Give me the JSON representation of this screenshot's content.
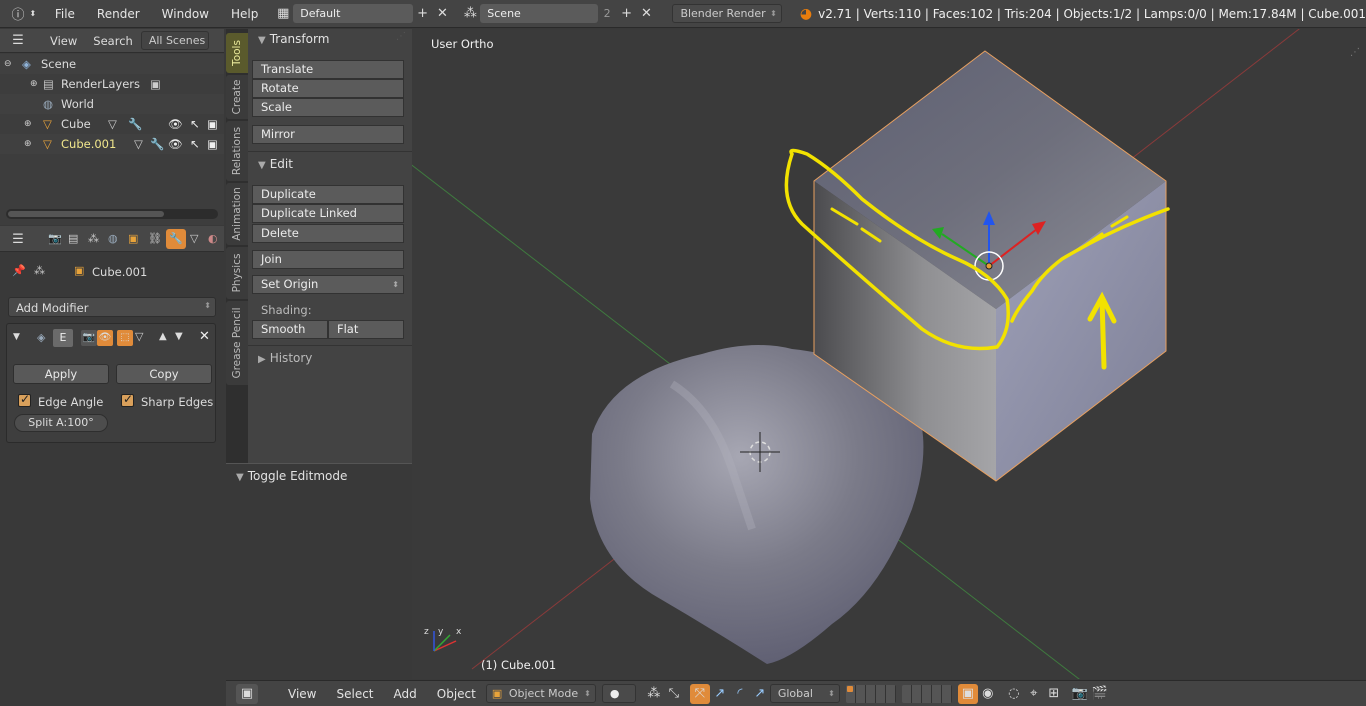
{
  "topbar": {
    "menus": [
      "File",
      "Render",
      "Window",
      "Help"
    ],
    "layout_name": "Default",
    "scene_name": "Scene",
    "scene_users": "2",
    "render_engine": "Blender Render",
    "stats": "v2.71 | Verts:110 | Faces:102 | Tris:204 | Objects:1/2 | Lamps:0/0 | Mem:17.84M | Cube.001"
  },
  "outliner": {
    "header": {
      "view": "View",
      "search": "Search",
      "filter": "All Scenes"
    },
    "rows": [
      {
        "label": "Scene",
        "icon": "scene-icon"
      },
      {
        "label": "RenderLayers",
        "icon": "renderlayers-icon"
      },
      {
        "label": "World",
        "icon": "world-icon"
      },
      {
        "label": "Cube",
        "icon": "mesh-object-icon"
      },
      {
        "label": "Cube.001",
        "icon": "mesh-object-icon",
        "selected": true
      }
    ]
  },
  "properties": {
    "object_name": "Cube.001",
    "add_modifier": "Add Modifier",
    "modifier_short": "E",
    "apply": "Apply",
    "copy": "Copy",
    "edge_angle": "Edge Angle",
    "sharp_edges": "Sharp Edges",
    "split_angle": "Split A:100°"
  },
  "tool_tabs": [
    "Tools",
    "Create",
    "Relations",
    "Animation",
    "Physics",
    "Grease Pencil"
  ],
  "tool_shelf": {
    "transform_title": "Transform",
    "translate": "Translate",
    "rotate": "Rotate",
    "scale": "Scale",
    "mirror": "Mirror",
    "edit_title": "Edit",
    "duplicate": "Duplicate",
    "duplicate_linked": "Duplicate Linked",
    "delete": "Delete",
    "join": "Join",
    "set_origin": "Set Origin",
    "shading_label": "Shading:",
    "smooth": "Smooth",
    "flat": "Flat",
    "history_title": "History",
    "toggle_editmode": "Toggle Editmode"
  },
  "viewport": {
    "view_label": "User Ortho",
    "object_label": "(1) Cube.001",
    "axis_x": "x",
    "axis_y": "y",
    "axis_z": "z"
  },
  "bottombar": {
    "view": "View",
    "select": "Select",
    "add": "Add",
    "object": "Object",
    "mode": "Object Mode",
    "orientation": "Global"
  },
  "colors": {
    "selected_text": "#f0e68c",
    "accent_orange": "#e08b3a",
    "annotation_yellow": "#f2e200"
  }
}
